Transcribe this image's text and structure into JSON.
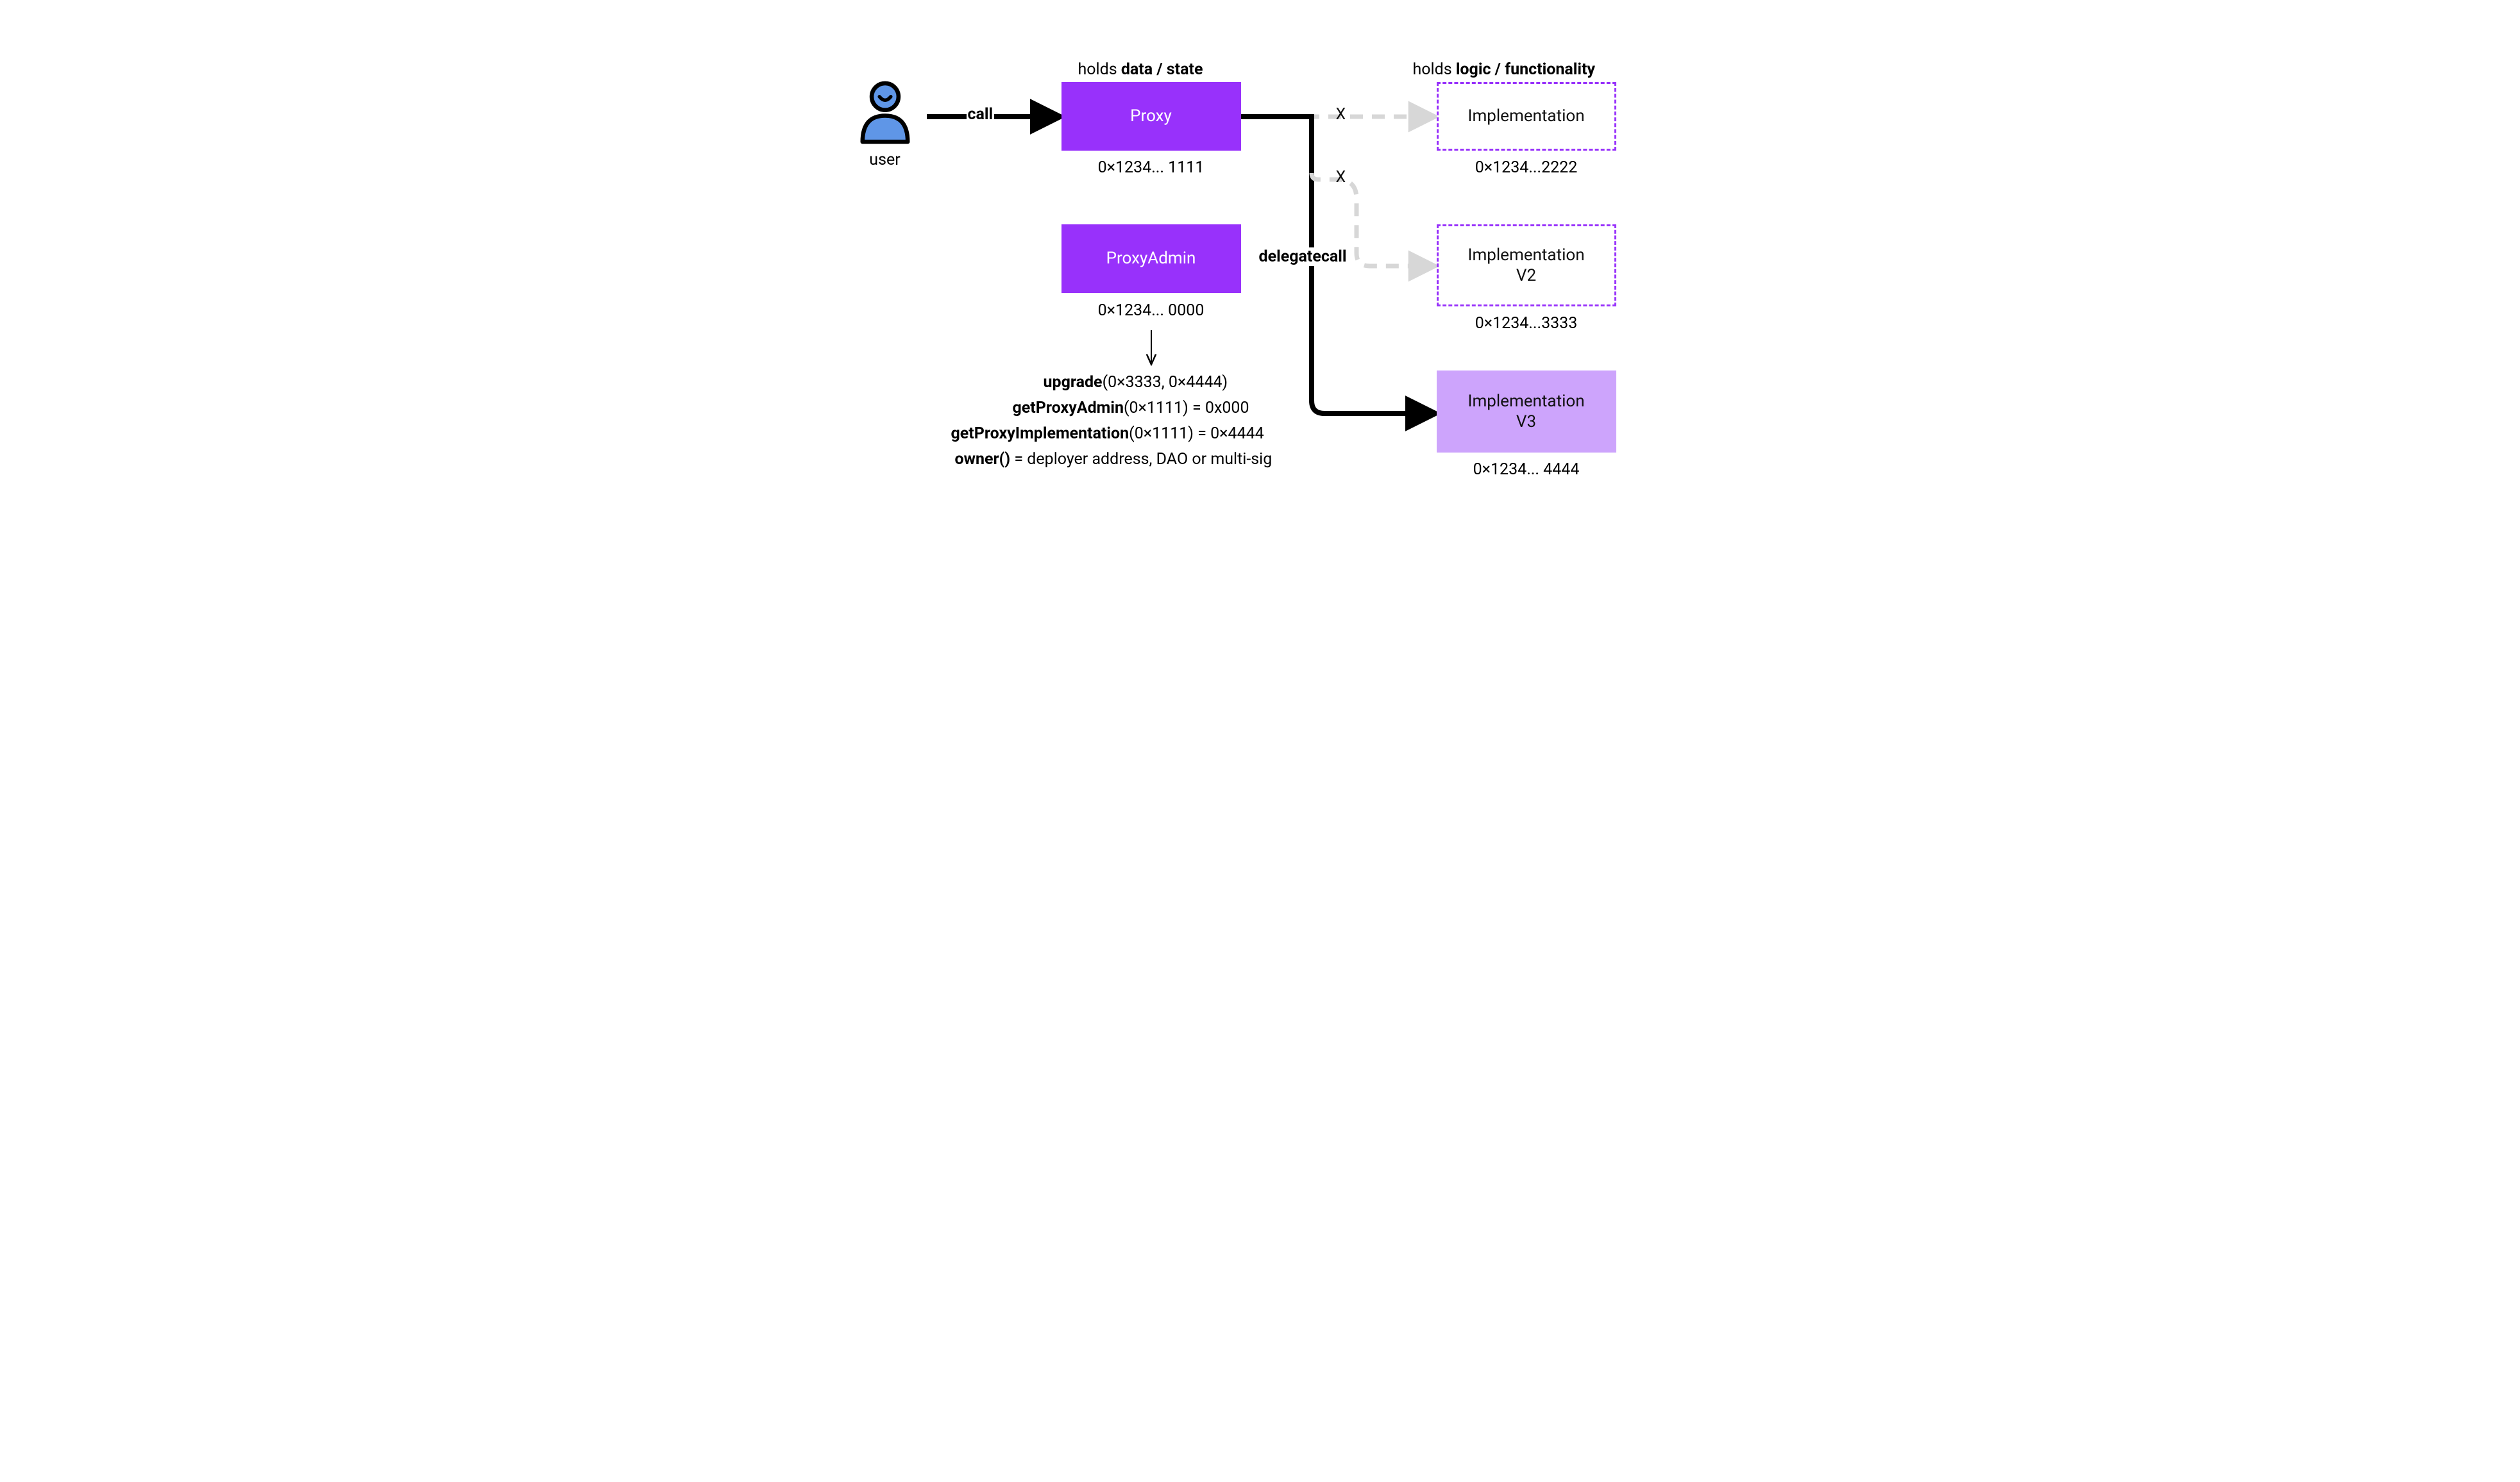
{
  "user": {
    "label": "user"
  },
  "headers": {
    "left_plain": "holds ",
    "left_bold": "data / state",
    "right_plain": "holds ",
    "right_bold": "logic / functionality"
  },
  "edges": {
    "call": "call",
    "delegatecall": "delegatecall",
    "x1": "X",
    "x2": "X"
  },
  "boxes": {
    "proxy": {
      "label": "Proxy",
      "addr": "0×1234... 1111"
    },
    "proxyAdmin": {
      "label": "ProxyAdmin",
      "addr": "0×1234... 0000"
    },
    "impl1": {
      "label": "Implementation",
      "addr": "0×1234...2222"
    },
    "impl2": {
      "label1": "Implementation",
      "label2": "V2",
      "addr": "0×1234...3333"
    },
    "impl3": {
      "label1": "Implementation",
      "label2": "V3",
      "addr": "0×1234... 4444"
    }
  },
  "fns": {
    "upgrade_fn": "upgrade",
    "upgrade_args": "(0×3333, 0×4444)",
    "getProxyAdmin_fn": "getProxyAdmin",
    "getProxyAdmin_args": "(0×1111) = 0x000",
    "getProxyImpl_fn": "getProxyImplementation",
    "getProxyImpl_args": "(0×1111) = 0×4444",
    "owner_fn": "owner()",
    "owner_args": " = deployer address, DAO or multi-sig"
  },
  "colors": {
    "purple": "#9831fb",
    "lightPurple": "#cda4fc",
    "userFill": "#5f96e7",
    "black": "#000000",
    "grey": "#d7d7d7"
  }
}
